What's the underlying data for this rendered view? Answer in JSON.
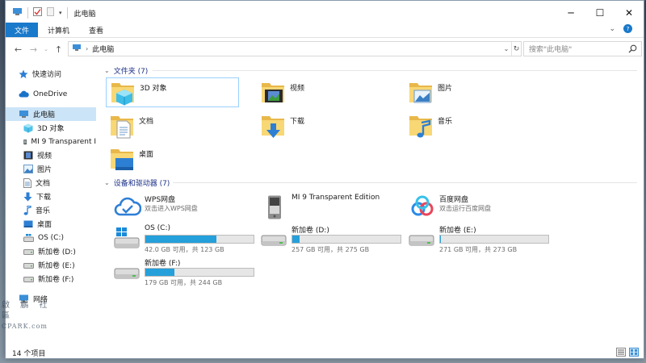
{
  "window": {
    "title": "此电脑"
  },
  "ribbon": {
    "tabs": [
      "文件",
      "计算机",
      "查看"
    ]
  },
  "address": {
    "path": "此电脑"
  },
  "search": {
    "placeholder": "搜索\"此电脑\""
  },
  "sidebar": {
    "quick_access": "快速访问",
    "onedrive": "OneDrive",
    "this_pc": "此电脑",
    "children": [
      "3D 对象",
      "MI 9 Transparent I",
      "视频",
      "图片",
      "文档",
      "下载",
      "音乐",
      "桌面",
      "OS (C:)",
      "新加卷 (D:)",
      "新加卷 (E:)",
      "新加卷 (F:)"
    ],
    "network": "网络"
  },
  "folders": {
    "header": "文件夹 (7)",
    "items": [
      "3D 对象",
      "视频",
      "图片",
      "文档",
      "下载",
      "音乐",
      "桌面"
    ]
  },
  "drives": {
    "header": "设备和驱动器 (7)",
    "items": [
      {
        "name": "WPS网盘",
        "sub": "双击进入WPS网盘"
      },
      {
        "name": "MI 9 Transparent Edition"
      },
      {
        "name": "百度网盘",
        "sub": "双击运行百度网盘"
      },
      {
        "name": "OS (C:)",
        "free": "42.0 GB 可用，共 123 GB",
        "used_fraction": 0.66
      },
      {
        "name": "新加卷 (D:)",
        "free": "257 GB 可用，共 275 GB",
        "used_fraction": 0.07
      },
      {
        "name": "新加卷 (E:)",
        "free": "271 GB 可用，共 273 GB",
        "used_fraction": 0.01
      },
      {
        "name": "新加卷 (F:)",
        "free": "179 GB 可用，共 244 GB",
        "used_fraction": 0.27
      }
    ]
  },
  "status": {
    "count": "14 个项目"
  },
  "watermark": {
    "line1": "啟 鵬 社 區",
    "line2": "CPARK.com"
  },
  "colors": {
    "accent": "#1979ca",
    "selection": "#cce4f7",
    "bar": "#26a0da",
    "group_header": "#1e3287"
  }
}
